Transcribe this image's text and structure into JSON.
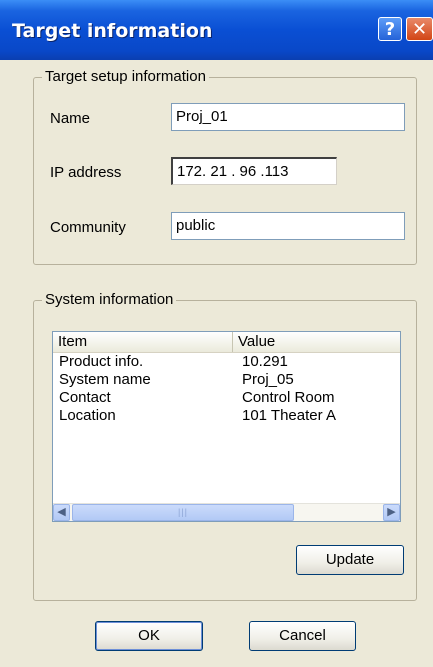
{
  "window": {
    "title": "Target information",
    "help_glyph": "?",
    "close_glyph": "✕"
  },
  "target_setup": {
    "legend": "Target setup information",
    "name_label": "Name",
    "name_value": "Proj_01",
    "ip_label": "IP address",
    "ip_value": "172. 21 . 96 .113",
    "community_label": "Community",
    "community_value": "public"
  },
  "system_info": {
    "legend": "System information",
    "columns": [
      "Item",
      "Value"
    ],
    "rows": [
      {
        "item": "Product info.",
        "value": "10.291"
      },
      {
        "item": "System name",
        "value": "Proj_05"
      },
      {
        "item": "Contact",
        "value": "Control Room"
      },
      {
        "item": "Location",
        "value": "101 Theater A"
      }
    ],
    "update_label": "Update"
  },
  "buttons": {
    "ok_label": "OK",
    "cancel_label": "Cancel"
  },
  "icons": {
    "help": "help-icon",
    "close": "close-icon",
    "scroll_left": "chevron-left-icon",
    "scroll_right": "chevron-right-icon"
  }
}
